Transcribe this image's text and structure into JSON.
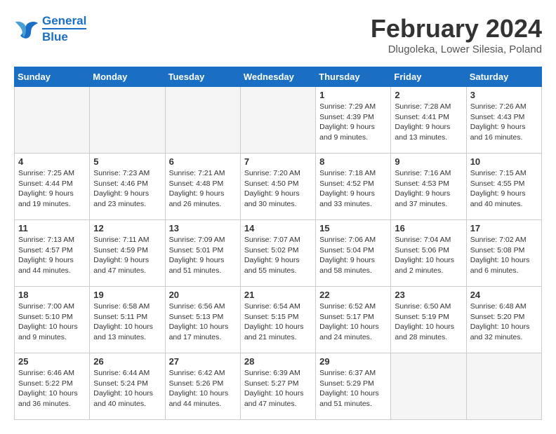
{
  "header": {
    "logo_line1": "General",
    "logo_line2": "Blue",
    "month": "February 2024",
    "location": "Dlugoleka, Lower Silesia, Poland"
  },
  "weekdays": [
    "Sunday",
    "Monday",
    "Tuesday",
    "Wednesday",
    "Thursday",
    "Friday",
    "Saturday"
  ],
  "weeks": [
    [
      {
        "day": "",
        "info": "",
        "empty": true
      },
      {
        "day": "",
        "info": "",
        "empty": true
      },
      {
        "day": "",
        "info": "",
        "empty": true
      },
      {
        "day": "",
        "info": "",
        "empty": true
      },
      {
        "day": "1",
        "info": "Sunrise: 7:29 AM\nSunset: 4:39 PM\nDaylight: 9 hours\nand 9 minutes."
      },
      {
        "day": "2",
        "info": "Sunrise: 7:28 AM\nSunset: 4:41 PM\nDaylight: 9 hours\nand 13 minutes."
      },
      {
        "day": "3",
        "info": "Sunrise: 7:26 AM\nSunset: 4:43 PM\nDaylight: 9 hours\nand 16 minutes."
      }
    ],
    [
      {
        "day": "4",
        "info": "Sunrise: 7:25 AM\nSunset: 4:44 PM\nDaylight: 9 hours\nand 19 minutes."
      },
      {
        "day": "5",
        "info": "Sunrise: 7:23 AM\nSunset: 4:46 PM\nDaylight: 9 hours\nand 23 minutes."
      },
      {
        "day": "6",
        "info": "Sunrise: 7:21 AM\nSunset: 4:48 PM\nDaylight: 9 hours\nand 26 minutes."
      },
      {
        "day": "7",
        "info": "Sunrise: 7:20 AM\nSunset: 4:50 PM\nDaylight: 9 hours\nand 30 minutes."
      },
      {
        "day": "8",
        "info": "Sunrise: 7:18 AM\nSunset: 4:52 PM\nDaylight: 9 hours\nand 33 minutes."
      },
      {
        "day": "9",
        "info": "Sunrise: 7:16 AM\nSunset: 4:53 PM\nDaylight: 9 hours\nand 37 minutes."
      },
      {
        "day": "10",
        "info": "Sunrise: 7:15 AM\nSunset: 4:55 PM\nDaylight: 9 hours\nand 40 minutes."
      }
    ],
    [
      {
        "day": "11",
        "info": "Sunrise: 7:13 AM\nSunset: 4:57 PM\nDaylight: 9 hours\nand 44 minutes."
      },
      {
        "day": "12",
        "info": "Sunrise: 7:11 AM\nSunset: 4:59 PM\nDaylight: 9 hours\nand 47 minutes."
      },
      {
        "day": "13",
        "info": "Sunrise: 7:09 AM\nSunset: 5:01 PM\nDaylight: 9 hours\nand 51 minutes."
      },
      {
        "day": "14",
        "info": "Sunrise: 7:07 AM\nSunset: 5:02 PM\nDaylight: 9 hours\nand 55 minutes."
      },
      {
        "day": "15",
        "info": "Sunrise: 7:06 AM\nSunset: 5:04 PM\nDaylight: 9 hours\nand 58 minutes."
      },
      {
        "day": "16",
        "info": "Sunrise: 7:04 AM\nSunset: 5:06 PM\nDaylight: 10 hours\nand 2 minutes."
      },
      {
        "day": "17",
        "info": "Sunrise: 7:02 AM\nSunset: 5:08 PM\nDaylight: 10 hours\nand 6 minutes."
      }
    ],
    [
      {
        "day": "18",
        "info": "Sunrise: 7:00 AM\nSunset: 5:10 PM\nDaylight: 10 hours\nand 9 minutes."
      },
      {
        "day": "19",
        "info": "Sunrise: 6:58 AM\nSunset: 5:11 PM\nDaylight: 10 hours\nand 13 minutes."
      },
      {
        "day": "20",
        "info": "Sunrise: 6:56 AM\nSunset: 5:13 PM\nDaylight: 10 hours\nand 17 minutes."
      },
      {
        "day": "21",
        "info": "Sunrise: 6:54 AM\nSunset: 5:15 PM\nDaylight: 10 hours\nand 21 minutes."
      },
      {
        "day": "22",
        "info": "Sunrise: 6:52 AM\nSunset: 5:17 PM\nDaylight: 10 hours\nand 24 minutes."
      },
      {
        "day": "23",
        "info": "Sunrise: 6:50 AM\nSunset: 5:19 PM\nDaylight: 10 hours\nand 28 minutes."
      },
      {
        "day": "24",
        "info": "Sunrise: 6:48 AM\nSunset: 5:20 PM\nDaylight: 10 hours\nand 32 minutes."
      }
    ],
    [
      {
        "day": "25",
        "info": "Sunrise: 6:46 AM\nSunset: 5:22 PM\nDaylight: 10 hours\nand 36 minutes."
      },
      {
        "day": "26",
        "info": "Sunrise: 6:44 AM\nSunset: 5:24 PM\nDaylight: 10 hours\nand 40 minutes."
      },
      {
        "day": "27",
        "info": "Sunrise: 6:42 AM\nSunset: 5:26 PM\nDaylight: 10 hours\nand 44 minutes."
      },
      {
        "day": "28",
        "info": "Sunrise: 6:39 AM\nSunset: 5:27 PM\nDaylight: 10 hours\nand 47 minutes."
      },
      {
        "day": "29",
        "info": "Sunrise: 6:37 AM\nSunset: 5:29 PM\nDaylight: 10 hours\nand 51 minutes."
      },
      {
        "day": "",
        "info": "",
        "empty": true
      },
      {
        "day": "",
        "info": "",
        "empty": true
      }
    ]
  ]
}
